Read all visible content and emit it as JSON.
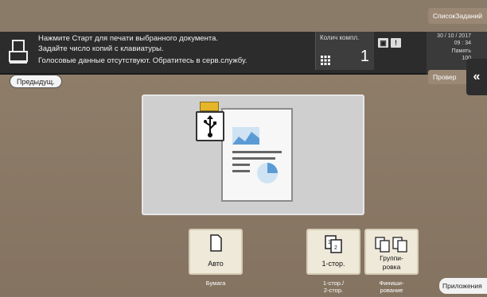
{
  "header": {
    "joblist_label": "СписокЗаданий",
    "check_label": "Провер"
  },
  "status": {
    "message_lines": [
      "Нажмите Старт для печати выбранного документа.",
      "Задайте число копий с клавиатуры.",
      "Голосовые данные отсутствуют. Обратитесь в серв.службу."
    ],
    "copies_label": "Колич компл.",
    "copies_value": "1",
    "date": "30 / 10 / 2017",
    "time": "09 : 34",
    "memory_label": "Память",
    "memory_value": "100"
  },
  "nav": {
    "prev_label": "Предыдущ."
  },
  "functions": [
    {
      "label": "Авто",
      "sublabel": "Бумага",
      "icon": "paper-icon"
    },
    {
      "label": "1-стор.",
      "sublabel": "1-стор./\n2-стор.",
      "icon": "duplex-icon"
    },
    {
      "label": "Группи-\nровка",
      "sublabel": "Финиши-\nрование",
      "icon": "group-icon"
    }
  ],
  "apps_label": "Приложения",
  "colors": {
    "background": "#8c7b68",
    "status_bar": "#2c2c2c",
    "usb_tab": "#e5b629",
    "chart_blue": "#5b9bd5"
  }
}
